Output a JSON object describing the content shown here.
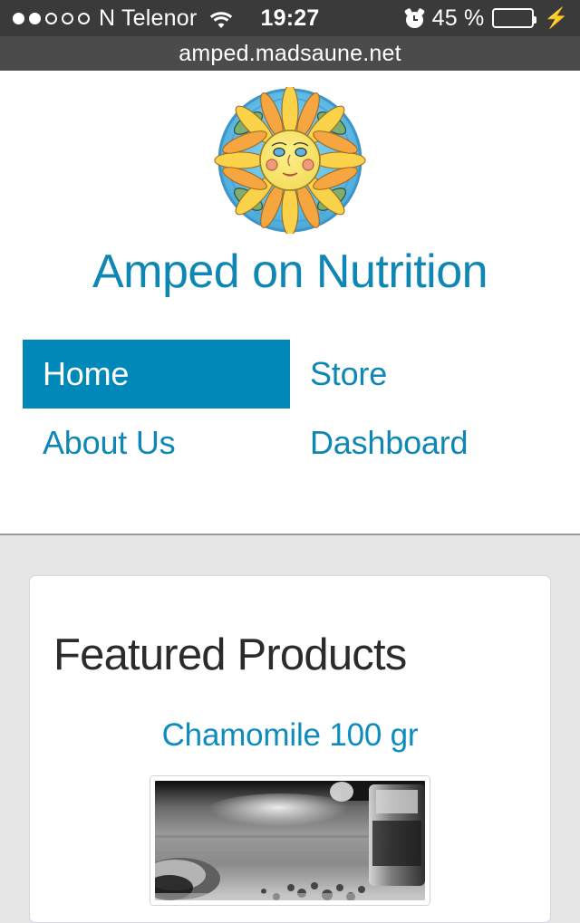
{
  "statusbar": {
    "signal_dots_filled": 2,
    "signal_dots_total": 5,
    "carrier": "N Telenor",
    "wifi_icon": "wifi-icon",
    "time": "19:27",
    "alarm_icon": "alarm-clock-icon",
    "battery_percent": "45 %",
    "battery_level": 45,
    "charging_icon": "lightning-bolt-icon",
    "battery_fill_color": "#4cd250"
  },
  "browser": {
    "url": "amped.madsaune.net"
  },
  "header": {
    "logo_icon": "sun-face-logo",
    "site_title": "Amped on Nutrition",
    "title_color": "#0e87b4"
  },
  "nav": {
    "active_bg": "#0089b8",
    "link_color": "#0e87b4",
    "items": [
      {
        "label": "Home",
        "active": true
      },
      {
        "label": "Store",
        "active": false
      },
      {
        "label": "About Us",
        "active": false
      },
      {
        "label": "Dashboard",
        "active": false
      }
    ]
  },
  "main": {
    "card_title": "Featured Products",
    "products": [
      {
        "name": "Chamomile 100 gr",
        "image_alt": "chamomile-product-photo"
      }
    ]
  }
}
